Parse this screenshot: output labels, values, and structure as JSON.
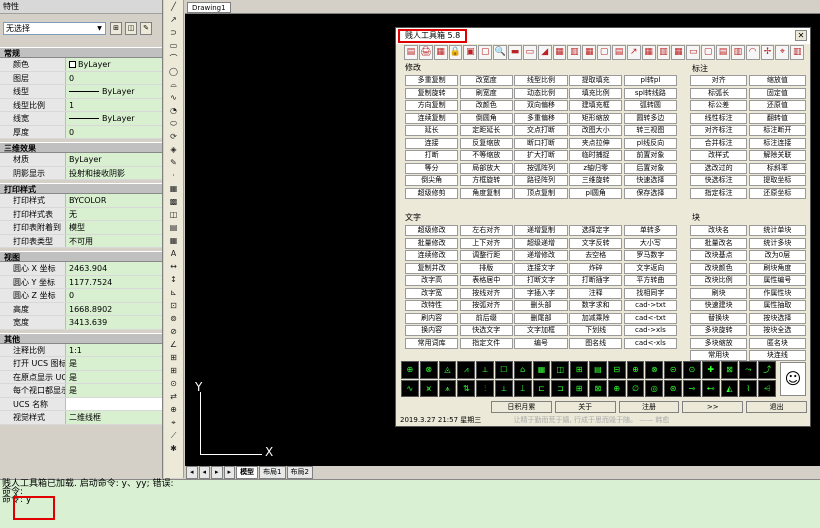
{
  "props": {
    "title": "特性",
    "selection": "无选择",
    "sections": [
      {
        "name": "常规",
        "rows": [
          {
            "k": "颜色",
            "v": "ByLayer",
            "kind": "chip"
          },
          {
            "k": "图层",
            "v": "0"
          },
          {
            "k": "线型",
            "v": "ByLayer",
            "kind": "line"
          },
          {
            "k": "线型比例",
            "v": "1"
          },
          {
            "k": "线宽",
            "v": "ByLayer",
            "kind": "line"
          },
          {
            "k": "厚度",
            "v": "0"
          }
        ]
      },
      {
        "name": "三维效果",
        "rows": [
          {
            "k": "材质",
            "v": "ByLayer"
          },
          {
            "k": "阴影显示",
            "v": "投射和接收阴影"
          }
        ]
      },
      {
        "name": "打印样式",
        "rows": [
          {
            "k": "打印样式",
            "v": "BYCOLOR"
          },
          {
            "k": "打印样式表",
            "v": "无"
          },
          {
            "k": "打印表附着到",
            "v": "模型"
          },
          {
            "k": "打印表类型",
            "v": "不可用"
          }
        ]
      },
      {
        "name": "视图",
        "rows": [
          {
            "k": "圆心 X 坐标",
            "v": "2463.904"
          },
          {
            "k": "圆心 Y 坐标",
            "v": "1177.7524"
          },
          {
            "k": "圆心 Z 坐标",
            "v": "0"
          },
          {
            "k": "高度",
            "v": "1668.8902"
          },
          {
            "k": "宽度",
            "v": "3413.639"
          }
        ]
      },
      {
        "name": "其他",
        "rows": [
          {
            "k": "注释比例",
            "v": "1:1"
          },
          {
            "k": "打开 UCS 图标",
            "v": "是"
          },
          {
            "k": "在原点显示 UCS…",
            "v": "是"
          },
          {
            "k": "每个视口都显示 …",
            "v": "是"
          },
          {
            "k": "UCS 名称",
            "v": "",
            "white": true
          },
          {
            "k": "视觉样式",
            "v": "二维线框"
          }
        ]
      }
    ]
  },
  "strip_icons": [
    "╱",
    "↗",
    "⊃",
    "▭",
    "⌒",
    "◯",
    "⌓",
    "∿",
    "◔",
    "⬭",
    "⟳",
    "◈",
    "✎",
    "·",
    "▦",
    "▩",
    "◫",
    "▤",
    "▦",
    "A",
    "↔",
    "↕",
    "⊾",
    "⊡",
    "⊚",
    "⊘",
    "∠",
    "⊞",
    "⊞",
    "⊙",
    "⇄",
    "⊕",
    "⌖",
    "⟋",
    "✱"
  ],
  "doc_tab": "Drawing1",
  "layout_tabs": [
    "◂",
    "◂",
    "▸",
    "▸",
    "模型",
    "布局1",
    "布局2"
  ],
  "ucs": {
    "y": "Y",
    "x": "X"
  },
  "command_lines": [
    "贱人工具箱已加载. 启动命令: y、yy; 错误:",
    "命令:",
    "命令: y"
  ],
  "toolbox": {
    "title": "贱人工具箱 5.8",
    "close": "✕",
    "icons": [
      "▤",
      "🖨",
      "▦",
      "🔒",
      "▣",
      "▢",
      "🔍",
      "▬",
      "▭",
      "◢",
      "▦",
      "▥",
      "▦",
      "▢",
      "▤",
      "↗",
      "▦",
      "▥",
      "▦",
      "▭",
      "▢",
      "▤",
      "▥",
      "◠",
      "✢",
      "⌖",
      "▥"
    ],
    "sec_modify": "修改",
    "sec_dim": "标注",
    "sec_text": "文字",
    "sec_block": "块",
    "modify": [
      "多重复制",
      "改宽度",
      "线型比例",
      "提取填充",
      "pl转pl",
      "复制旋转",
      "刷宽度",
      "动态比例",
      "填充比例",
      "spl转线路",
      "方向复制",
      "改颜色",
      "双向偏移",
      "建填充框",
      "弧转圆",
      "连续复制",
      "倒圆角",
      "多重偏移",
      "矩形缩放",
      "圆转多边",
      "延长",
      "定距延长",
      "交点打断",
      "改图大小",
      "转三视图",
      "连接",
      "反复缩放",
      "断口打断",
      "夹点拉伸",
      "pl线反向",
      "打断",
      "不等缩放",
      "扩大打断",
      "临时捕捉",
      "前置对象",
      "等分",
      "局部放大",
      "按弧阵列",
      "z轴归零",
      "后置对象",
      "倒尖角",
      "方框旋转",
      "路径阵列",
      "三维旋转",
      "快速选择",
      "超级修剪",
      "角度复制",
      "顶点复制",
      "pl圆角",
      "保存选择"
    ],
    "dim": [
      "对齐",
      "缩放值",
      "标弧长",
      "固定值",
      "标公差",
      "还原值",
      "线性标注",
      "翻转值",
      "对齐标注",
      "标注断开",
      "合并标注",
      "标注连接",
      "改样式",
      "解除关联",
      "选改过的",
      "标斜率",
      "快选标注",
      "提取坐标",
      "指定标注",
      "还原坐标"
    ],
    "text": [
      "超级修改",
      "左右对齐",
      "递增复制",
      "选择定字",
      "单转多",
      "批量修改",
      "上下对齐",
      "超级递增",
      "文字反转",
      "大小写",
      "连续修改",
      "调整行距",
      "递增修改",
      "去空格",
      "罗马数字",
      "复制并改",
      "排版",
      "连接文字",
      "炸碎",
      "文字返向",
      "改字高",
      "表格居中",
      "打断文字",
      "打断插字",
      "平方转曲",
      "改字宽",
      "按线对齐",
      "字插入字",
      "注释",
      "找相同字",
      "改特性",
      "按弧对齐",
      "删头部",
      "数字求和",
      "cad->txt",
      "刷内容",
      "前后缀",
      "删尾部",
      "加减乘除",
      "cad<-txt",
      "换内容",
      "快选文字",
      "文字加框",
      "下划线",
      "cad->xls",
      "常用词库",
      "指定文件",
      "编号",
      "图名线",
      "cad<-xls"
    ],
    "block": [
      "改块名",
      "统计单块",
      "批量改名",
      "统计多块",
      "改块基点",
      "改为0层",
      "改块颜色",
      "刷块角度",
      "改块比例",
      "属性编号",
      "刷块",
      "作属性块",
      "快速建块",
      "属性抽取",
      "替换块",
      "按块选择",
      "多块旋转",
      "按块全选",
      "多块缩放",
      "匿名块",
      "常用块",
      "块连线"
    ],
    "samples": [
      "⊕",
      "⊗",
      "◬",
      "⩘",
      "⟂",
      "☐",
      "⌂",
      "▦",
      "◫",
      "⊞",
      "▤",
      "⊟",
      "⊕",
      "⊗",
      "⊝",
      "⊙",
      "✚",
      "⊠",
      "⤳",
      "⤴",
      "∿",
      "⩙",
      "⩚",
      "⇅",
      "⫶",
      "⟂",
      "⟘",
      "⊏",
      "⊐",
      "⊞",
      "⊠",
      "⊕",
      "∅",
      "◎",
      "⊛",
      "⊸",
      "⊷",
      "◭",
      "⌇",
      "⩤"
    ],
    "face": "☺",
    "buttons": [
      "日积月累",
      "关于",
      "注册",
      ">>",
      "退出"
    ],
    "status_date": "2019.3.27",
    "status_time": "21:57",
    "status_day": "星期三",
    "status_tip": "让精于勤而荒于嬉, 行成于思而毁于随。 —— 韩愈"
  }
}
